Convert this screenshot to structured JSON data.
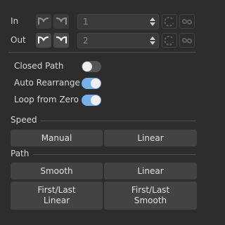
{
  "rows": {
    "in": {
      "label": "In",
      "value": "1"
    },
    "out": {
      "label": "Out",
      "value": "2"
    }
  },
  "toggles": [
    {
      "label": "Closed Path",
      "on": false
    },
    {
      "label": "Auto Rearrange",
      "on": true
    },
    {
      "label": "Loop from Zero",
      "on": true
    }
  ],
  "speed": {
    "title": "Speed",
    "buttons": [
      "Manual",
      "Linear"
    ]
  },
  "path": {
    "title": "Path",
    "buttons": [
      "Smooth",
      "Linear",
      "First/Last\nLinear",
      "First/Last\nSmooth"
    ]
  },
  "colors": {
    "background": "#2d2d2d",
    "toggle_on": "#79afe8",
    "button": "#434343"
  },
  "icons": [
    "ease-in-curve-icon",
    "ease-out-curve-icon",
    "link-rotate-icon",
    "infinity-icon"
  ]
}
